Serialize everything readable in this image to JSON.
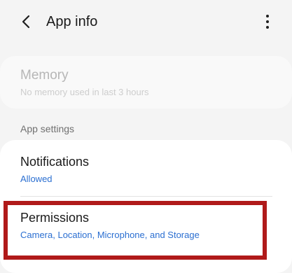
{
  "header": {
    "title": "App info",
    "back_icon": "chevron-left-icon",
    "more_icon": "more-vertical-icon"
  },
  "memory": {
    "title": "Memory",
    "subtitle": "No memory used in last 3 hours"
  },
  "app_settings": {
    "header": "App settings",
    "items": [
      {
        "title": "Notifications",
        "subtitle": "Allowed"
      },
      {
        "title": "Permissions",
        "subtitle": "Camera, Location, Microphone, and Storage"
      }
    ]
  },
  "colors": {
    "background": "#f4f4f4",
    "card": "#ffffff",
    "accent_link": "#2b6fd1",
    "highlight": "#b01a1a",
    "disabled_text": "#b6b6b6"
  }
}
